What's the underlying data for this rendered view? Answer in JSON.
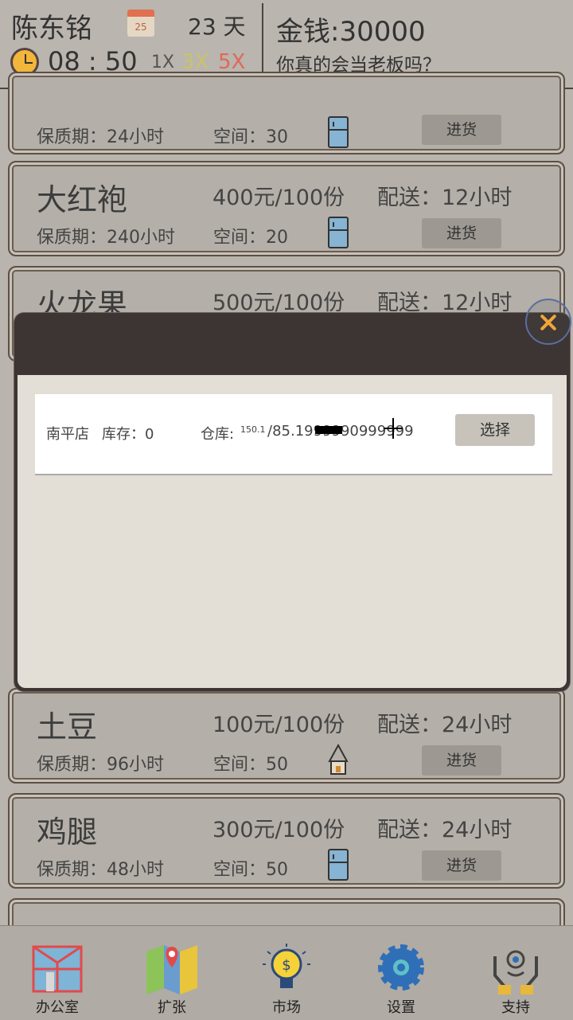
{
  "header": {
    "player_name": "陈东铭",
    "calendar_day": "25",
    "day_count": "23 天",
    "time": "08 : 50",
    "speeds": [
      {
        "label": "1X",
        "color": "#555555"
      },
      {
        "label": "3X",
        "color": "#c9c36a"
      },
      {
        "label": "5X",
        "color": "#e0685a"
      }
    ],
    "money": "金钱:30000",
    "slogan": "你真的会当老板吗？"
  },
  "products": [
    {
      "name": "",
      "price": "",
      "delivery": "",
      "shelf_life": "保质期：24小时",
      "space": "空间：30",
      "icon": "fridge-icon",
      "button": "进货"
    },
    {
      "name": "大红袍",
      "price": "400元/100份",
      "delivery": "配送：12小时",
      "shelf_life": "保质期：240小时",
      "space": "空间：20",
      "icon": "fridge-icon",
      "button": "进货"
    },
    {
      "name": "火龙果",
      "price": "500元/100份",
      "delivery": "配送：12小时",
      "shelf_life": "",
      "space": "",
      "icon": "",
      "button": ""
    },
    {
      "name": "土豆",
      "price": "100元/100份",
      "delivery": "配送：24小时",
      "shelf_life": "保质期：96小时",
      "space": "空间：50",
      "icon": "shelf-icon",
      "button": "进货"
    },
    {
      "name": "鸡腿",
      "price": "300元/100份",
      "delivery": "配送：24小时",
      "shelf_life": "保质期：48小时",
      "space": "空间：50",
      "icon": "fridge-icon",
      "button": "进货"
    }
  ],
  "dialog": {
    "rows": [
      {
        "store": "南平店",
        "stock": "库存：0",
        "warehouse_label": "仓库:",
        "warehouse_small": "150.1",
        "warehouse_value": "/85.1999990999999",
        "button": "选择"
      }
    ]
  },
  "nav": [
    {
      "label": "办公室",
      "icon": "office-building-icon"
    },
    {
      "label": "扩张",
      "icon": "map-pin-icon"
    },
    {
      "label": "市场",
      "icon": "lightbulb-dollar-icon"
    },
    {
      "label": "设置",
      "icon": "gear-icon"
    },
    {
      "label": "支持",
      "icon": "support-hands-icon"
    }
  ]
}
